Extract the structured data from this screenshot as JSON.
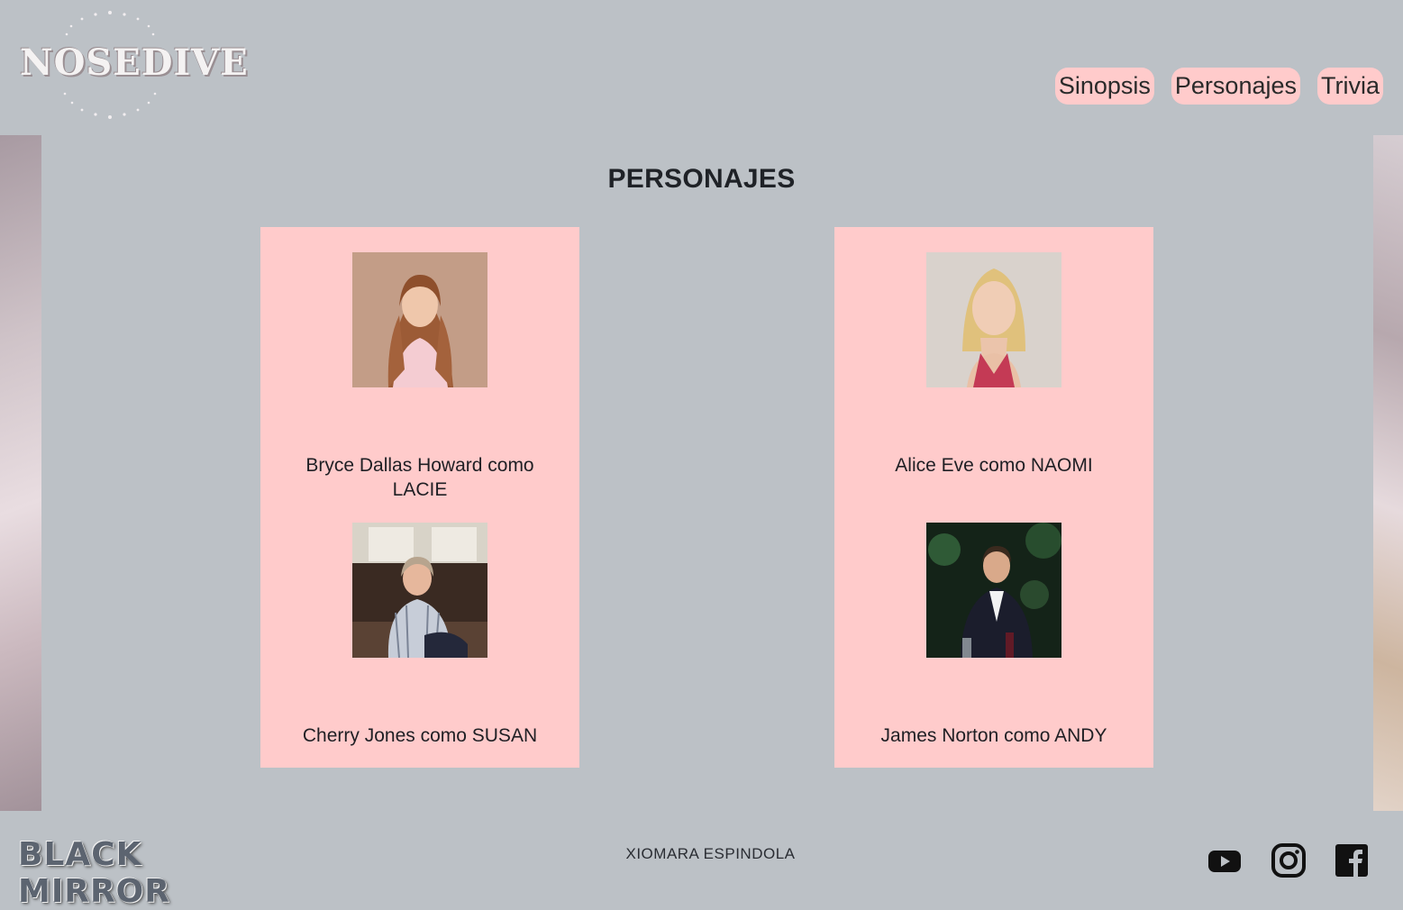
{
  "header": {
    "logo_text": "NOSEDIVE",
    "nav": [
      {
        "label": "Sinopsis"
      },
      {
        "label": "Personajes"
      },
      {
        "label": "Trivia"
      }
    ]
  },
  "main": {
    "title": "PERSONAJES",
    "cards": [
      {
        "people": [
          {
            "name": "Bryce Dallas Howard como LACIE"
          },
          {
            "name": "Cherry Jones como SUSAN"
          }
        ]
      },
      {
        "people": [
          {
            "name": "Alice Eve como NAOMI"
          },
          {
            "name": "James Norton como ANDY"
          }
        ]
      }
    ]
  },
  "footer": {
    "brand": "BLACK MIRROR",
    "author": "XIOMARA ESPINDOLA",
    "social": [
      "youtube-icon",
      "instagram-icon",
      "facebook-icon"
    ]
  },
  "colors": {
    "background": "#bcc1c6",
    "accent": "#ffcbcb",
    "text": "#1f2227"
  }
}
